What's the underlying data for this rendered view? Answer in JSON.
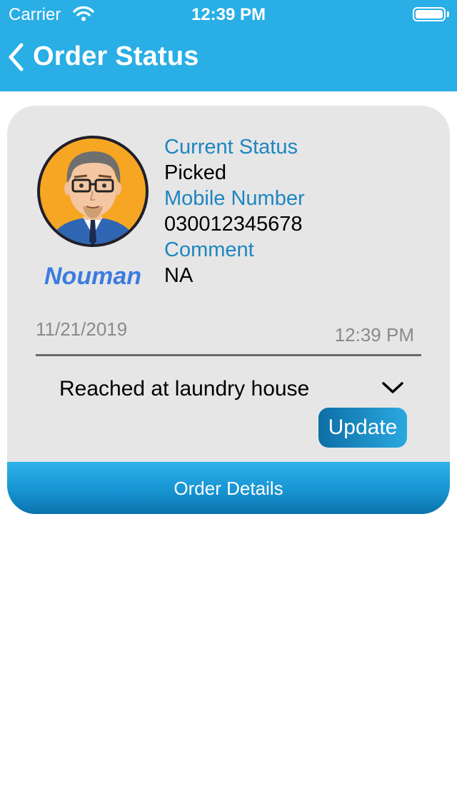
{
  "status_bar": {
    "carrier": "Carrier",
    "time": "12:39 PM",
    "battery_level": 1.0
  },
  "header": {
    "title": "Order Status"
  },
  "order": {
    "user_name": "Nouman",
    "current_status_label": "Current Status",
    "current_status": " Picked",
    "mobile_label": "Mobile Number",
    "mobile": "030012345678",
    "comment_label": "Comment",
    "comment": " NA",
    "date": "11/21/2019",
    "time": "12:39 PM",
    "status_select": "Reached at laundry house",
    "update_label": "Update",
    "details_label": "Order Details"
  },
  "colors": {
    "header": "#29aee6",
    "card": "#e6e6e7",
    "label": "#1e86bf",
    "name": "#3c7be0"
  },
  "icons": {
    "back": "chevron-left-icon",
    "dropdown": "chevron-down-icon",
    "wifi": "wifi-icon",
    "battery": "battery-icon"
  }
}
